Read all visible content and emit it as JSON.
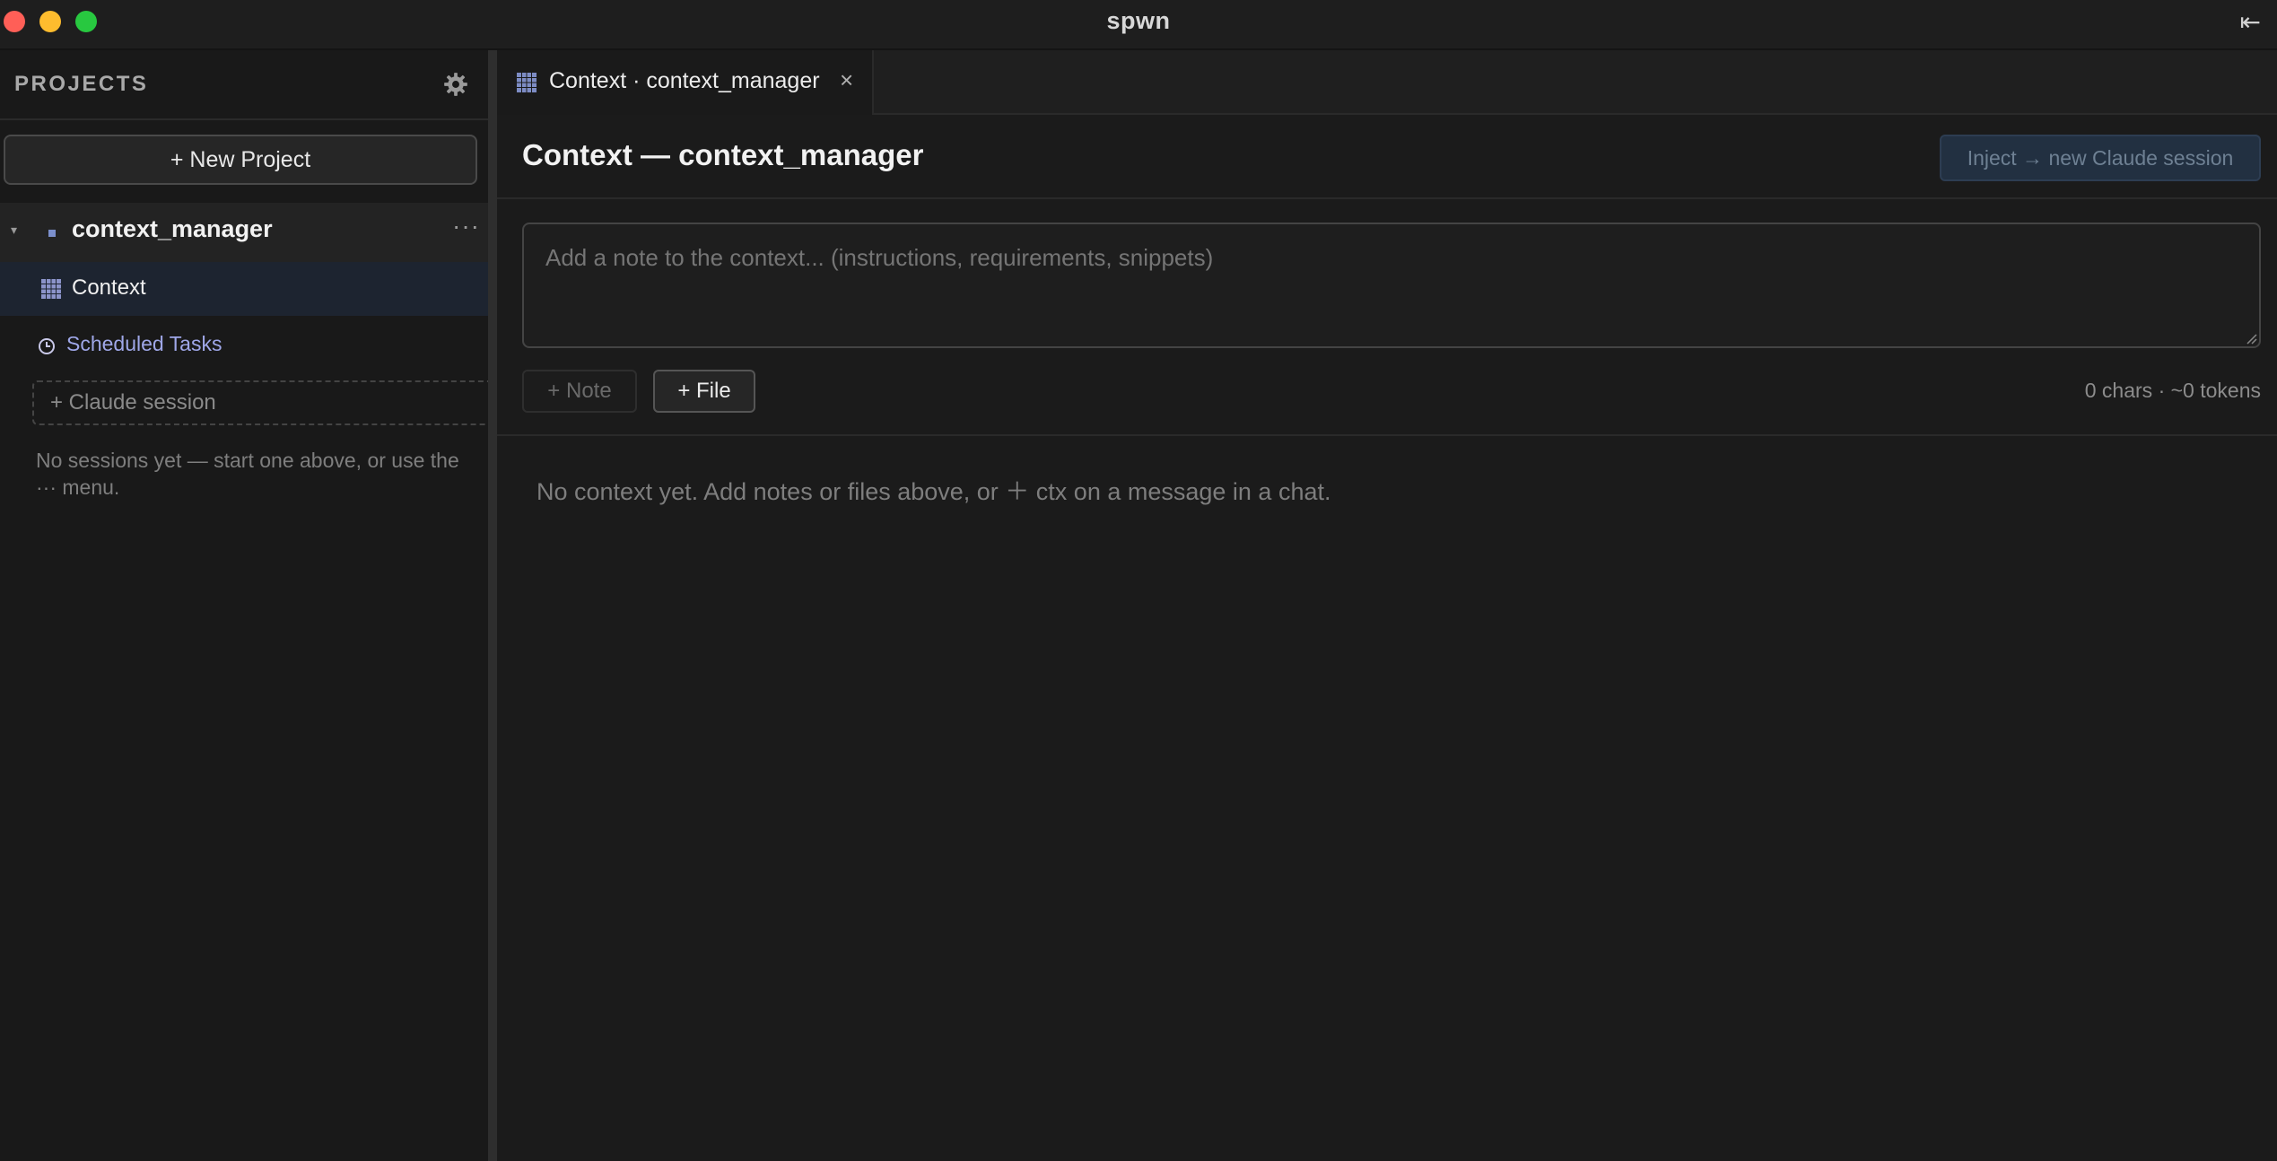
{
  "window": {
    "title": "spwn",
    "collapse_icon": "⇤"
  },
  "sidebar": {
    "title": "PROJECTS",
    "new_project_label": "+ New Project",
    "project": {
      "name": "context_manager",
      "more": "···",
      "caret": "▾"
    },
    "items": [
      {
        "label": "Context",
        "icon": "grid-icon",
        "selected": true
      },
      {
        "label": "Scheduled Tasks",
        "icon": "clock-icon"
      }
    ],
    "claude_session_label": "+ Claude session",
    "empty_text": "No sessions yet — start one above, or use the ··· menu."
  },
  "tabs": [
    {
      "label": "Context · context_manager",
      "close": "×",
      "icon": "grid-icon"
    }
  ],
  "context": {
    "title": "Context — context_manager",
    "inject_label": "Inject → new Claude session",
    "note_placeholder": "Add a note to the context... (instructions, requirements, snippets)",
    "note_button": "+ Note",
    "file_button": "+ File",
    "char_count": "0 chars · ~0 tokens",
    "empty_message": "No context yet. Add notes or files above, or ＋ ctx on a message in a chat."
  },
  "colors": {
    "accent": "#9fa7e8",
    "icon_grid": "#8b93c9",
    "selected_row": "#1d2430",
    "inject_bg": "#223041"
  }
}
